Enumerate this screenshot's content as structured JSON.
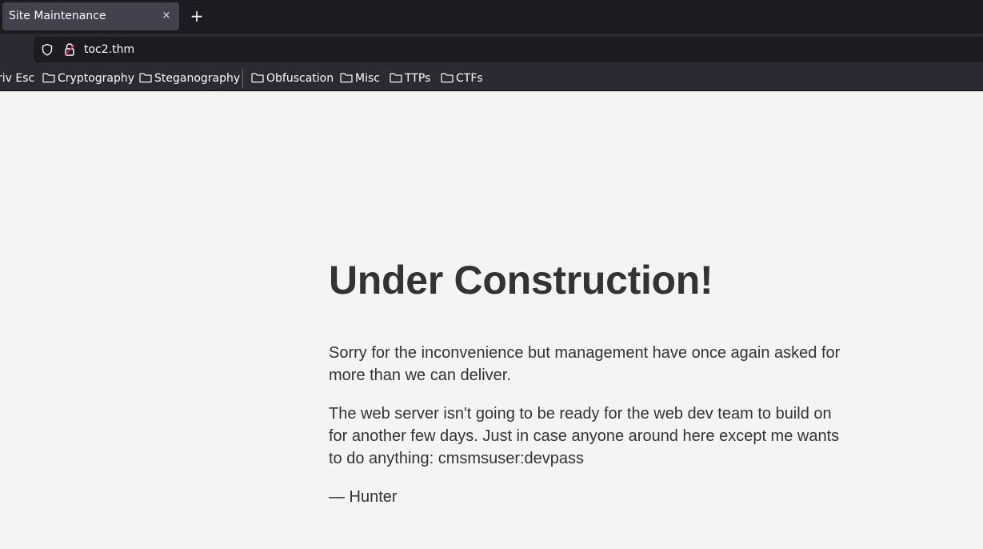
{
  "browser": {
    "tab": {
      "title": "Site Maintenance",
      "close_glyph": "×"
    },
    "new_tab_glyph": "+",
    "address_bar": {
      "url": "toc2.thm",
      "icons": [
        "shield-icon",
        "lock-icon"
      ]
    },
    "bookmarks": [
      {
        "label": "riv Esc",
        "icon": ""
      },
      {
        "label": "Cryptography",
        "icon": "folder-icon"
      },
      {
        "label": "Steganography",
        "icon": "folder-icon"
      },
      {
        "label": "Obfuscation",
        "icon": "folder-icon"
      },
      {
        "label": "Misc",
        "icon": "folder-icon"
      },
      {
        "label": "TTPs",
        "icon": "folder-icon"
      },
      {
        "label": "CTFs",
        "icon": "folder-icon"
      }
    ],
    "colors": {
      "chrome_dark": "#1c1b22",
      "chrome": "#2b2a33",
      "tab_active": "#42414d"
    }
  },
  "page": {
    "heading": "Under Construction!",
    "paragraphs": [
      "Sorry for the inconvenience but management have once again asked for more than we can deliver.",
      "The web server isn't going to be ready for the web dev team to build on for another few days. Just in case anyone around here except me wants to do anything: cmsmsuser:devpass"
    ],
    "signature": "— Hunter",
    "colors": {
      "background": "#f5f4f2",
      "text": "#333333"
    }
  }
}
